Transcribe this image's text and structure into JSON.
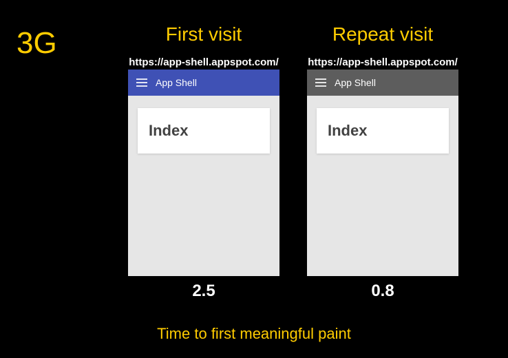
{
  "network": "3G",
  "caption": "Time to first meaningful paint",
  "columns": [
    {
      "title": "First visit",
      "url": "https://app-shell.appspot.com/",
      "app_title": "App Shell",
      "card_title": "Index",
      "timing": "2.5",
      "header_variant": "blue"
    },
    {
      "title": "Repeat visit",
      "url": "https://app-shell.appspot.com/",
      "app_title": "App Shell",
      "card_title": "Index",
      "timing": "0.8",
      "header_variant": "grey"
    }
  ]
}
